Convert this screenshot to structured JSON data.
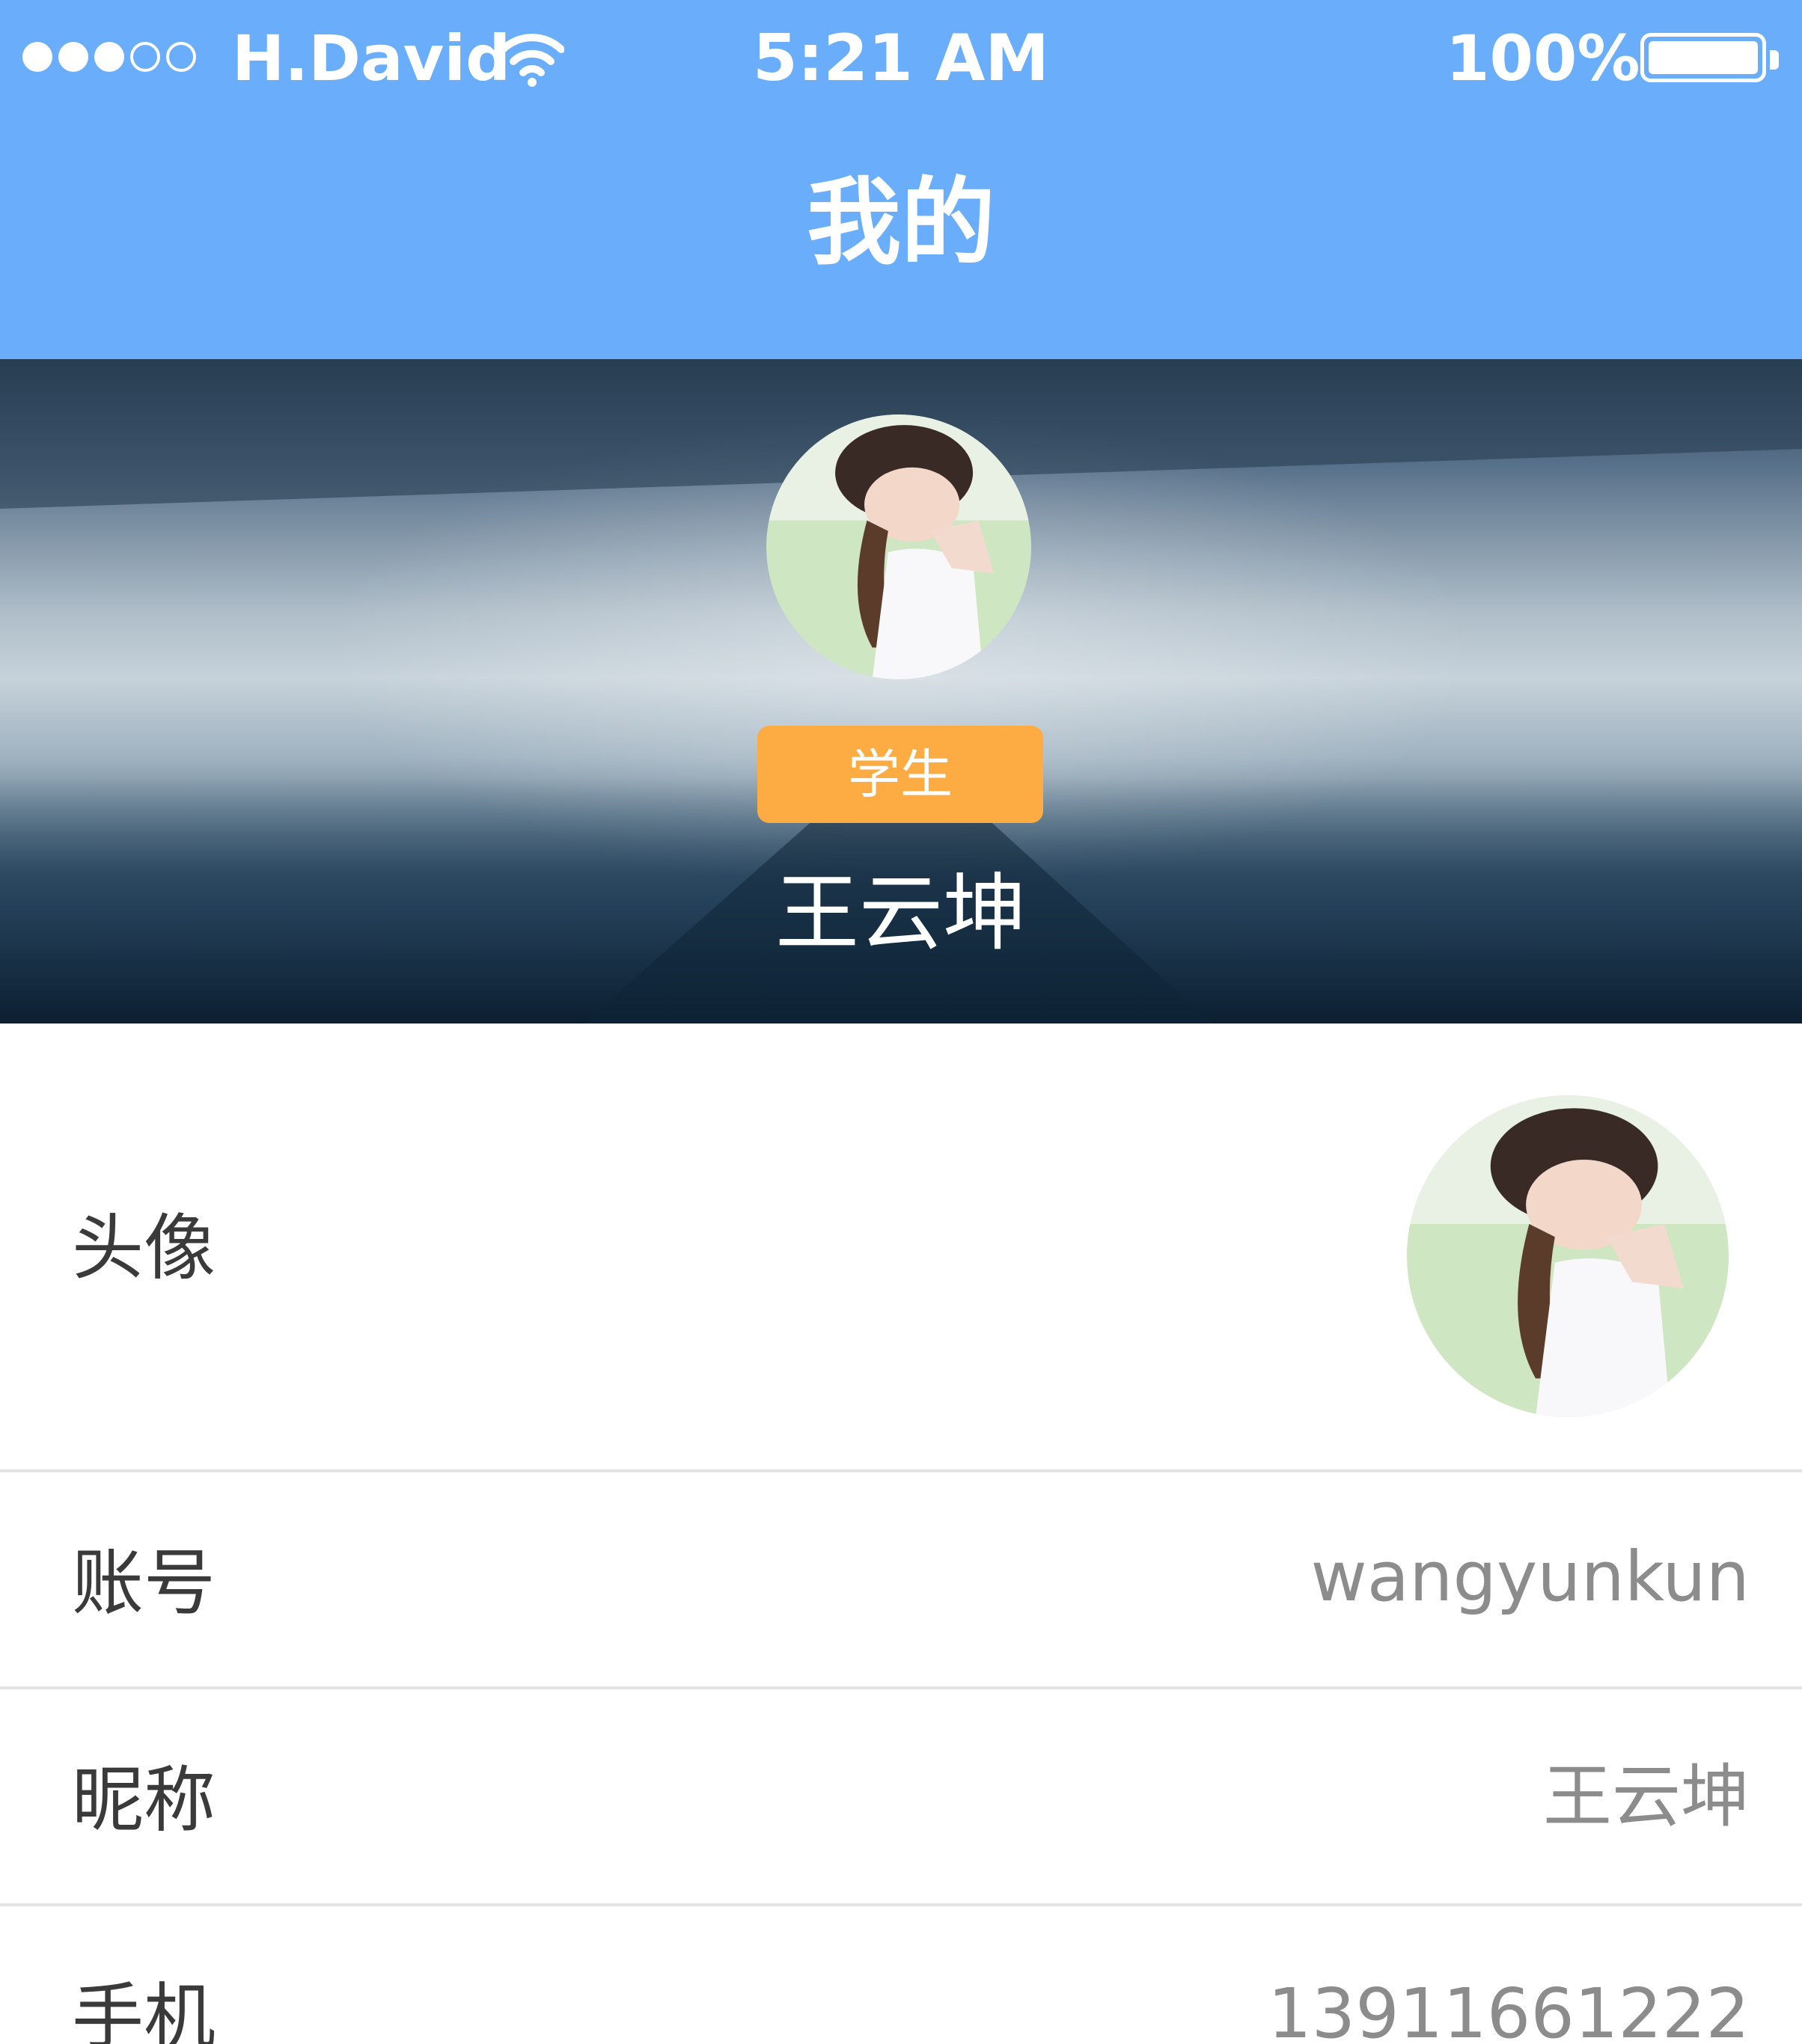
{
  "status_bar": {
    "signal_bars_filled": 3,
    "signal_bars_total": 5,
    "carrier": "H.David",
    "time": "5:21 AM",
    "battery_percent": "100%",
    "icons": [
      "wifi-icon",
      "battery-icon"
    ]
  },
  "nav": {
    "title": "我的"
  },
  "profile_header": {
    "role_badge": "学生",
    "name": "王云坤"
  },
  "rows": [
    {
      "label": "头像",
      "value": ""
    },
    {
      "label": "账号",
      "value": "wangyunkun"
    },
    {
      "label": "昵称",
      "value": "王云坤"
    },
    {
      "label": "手机",
      "value": "13911661222"
    }
  ],
  "colors": {
    "nav_blue": "#6aaefb",
    "badge_orange": "#fdac44",
    "label_text": "#3a3a3a",
    "value_text": "#8c8c8c"
  }
}
